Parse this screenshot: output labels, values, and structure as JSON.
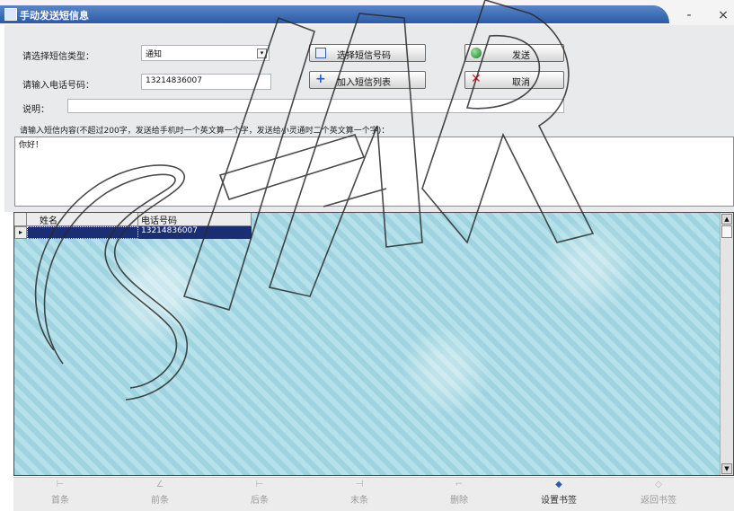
{
  "window": {
    "title": "手动发送短信息",
    "minimize_label": "-",
    "close_label": "×"
  },
  "form": {
    "type_label": "请选择短信类型：",
    "type_value": "通知",
    "phone_label": "请输入电话号码：",
    "phone_value": "13214836007",
    "note_label": "说明：",
    "note_value": "",
    "hint": "请输入短信内容(不超过200字，发送给手机时一个英文算一个字，发送给小灵通时二个英文算一个字)：",
    "message_value": "你好！"
  },
  "buttons": {
    "select_numbers": "选择短信号码",
    "send": "发送",
    "add_to_list": "加入短信列表",
    "cancel": "取消"
  },
  "grid": {
    "columns": [
      "姓名",
      "电话号码"
    ],
    "rows": [
      {
        "name": "",
        "phone": "13214836007"
      }
    ],
    "row_marker": "▸"
  },
  "bottom_nav": {
    "items": [
      {
        "label": "首条",
        "icon": "⊢"
      },
      {
        "label": "前条",
        "icon": "∠"
      },
      {
        "label": "后条",
        "icon": "⊢"
      },
      {
        "label": "末条",
        "icon": "⊣"
      },
      {
        "label": "删除",
        "icon": "⌐"
      },
      {
        "label": "设置书签",
        "icon": "◆"
      },
      {
        "label": "返回书签",
        "icon": "◇"
      }
    ]
  },
  "watermark": {
    "text": "STAR"
  },
  "colors": {
    "title_bar": "#2b5aa6",
    "selected_row": "#1a2f73",
    "grid_bg": "#a7d8e3"
  }
}
